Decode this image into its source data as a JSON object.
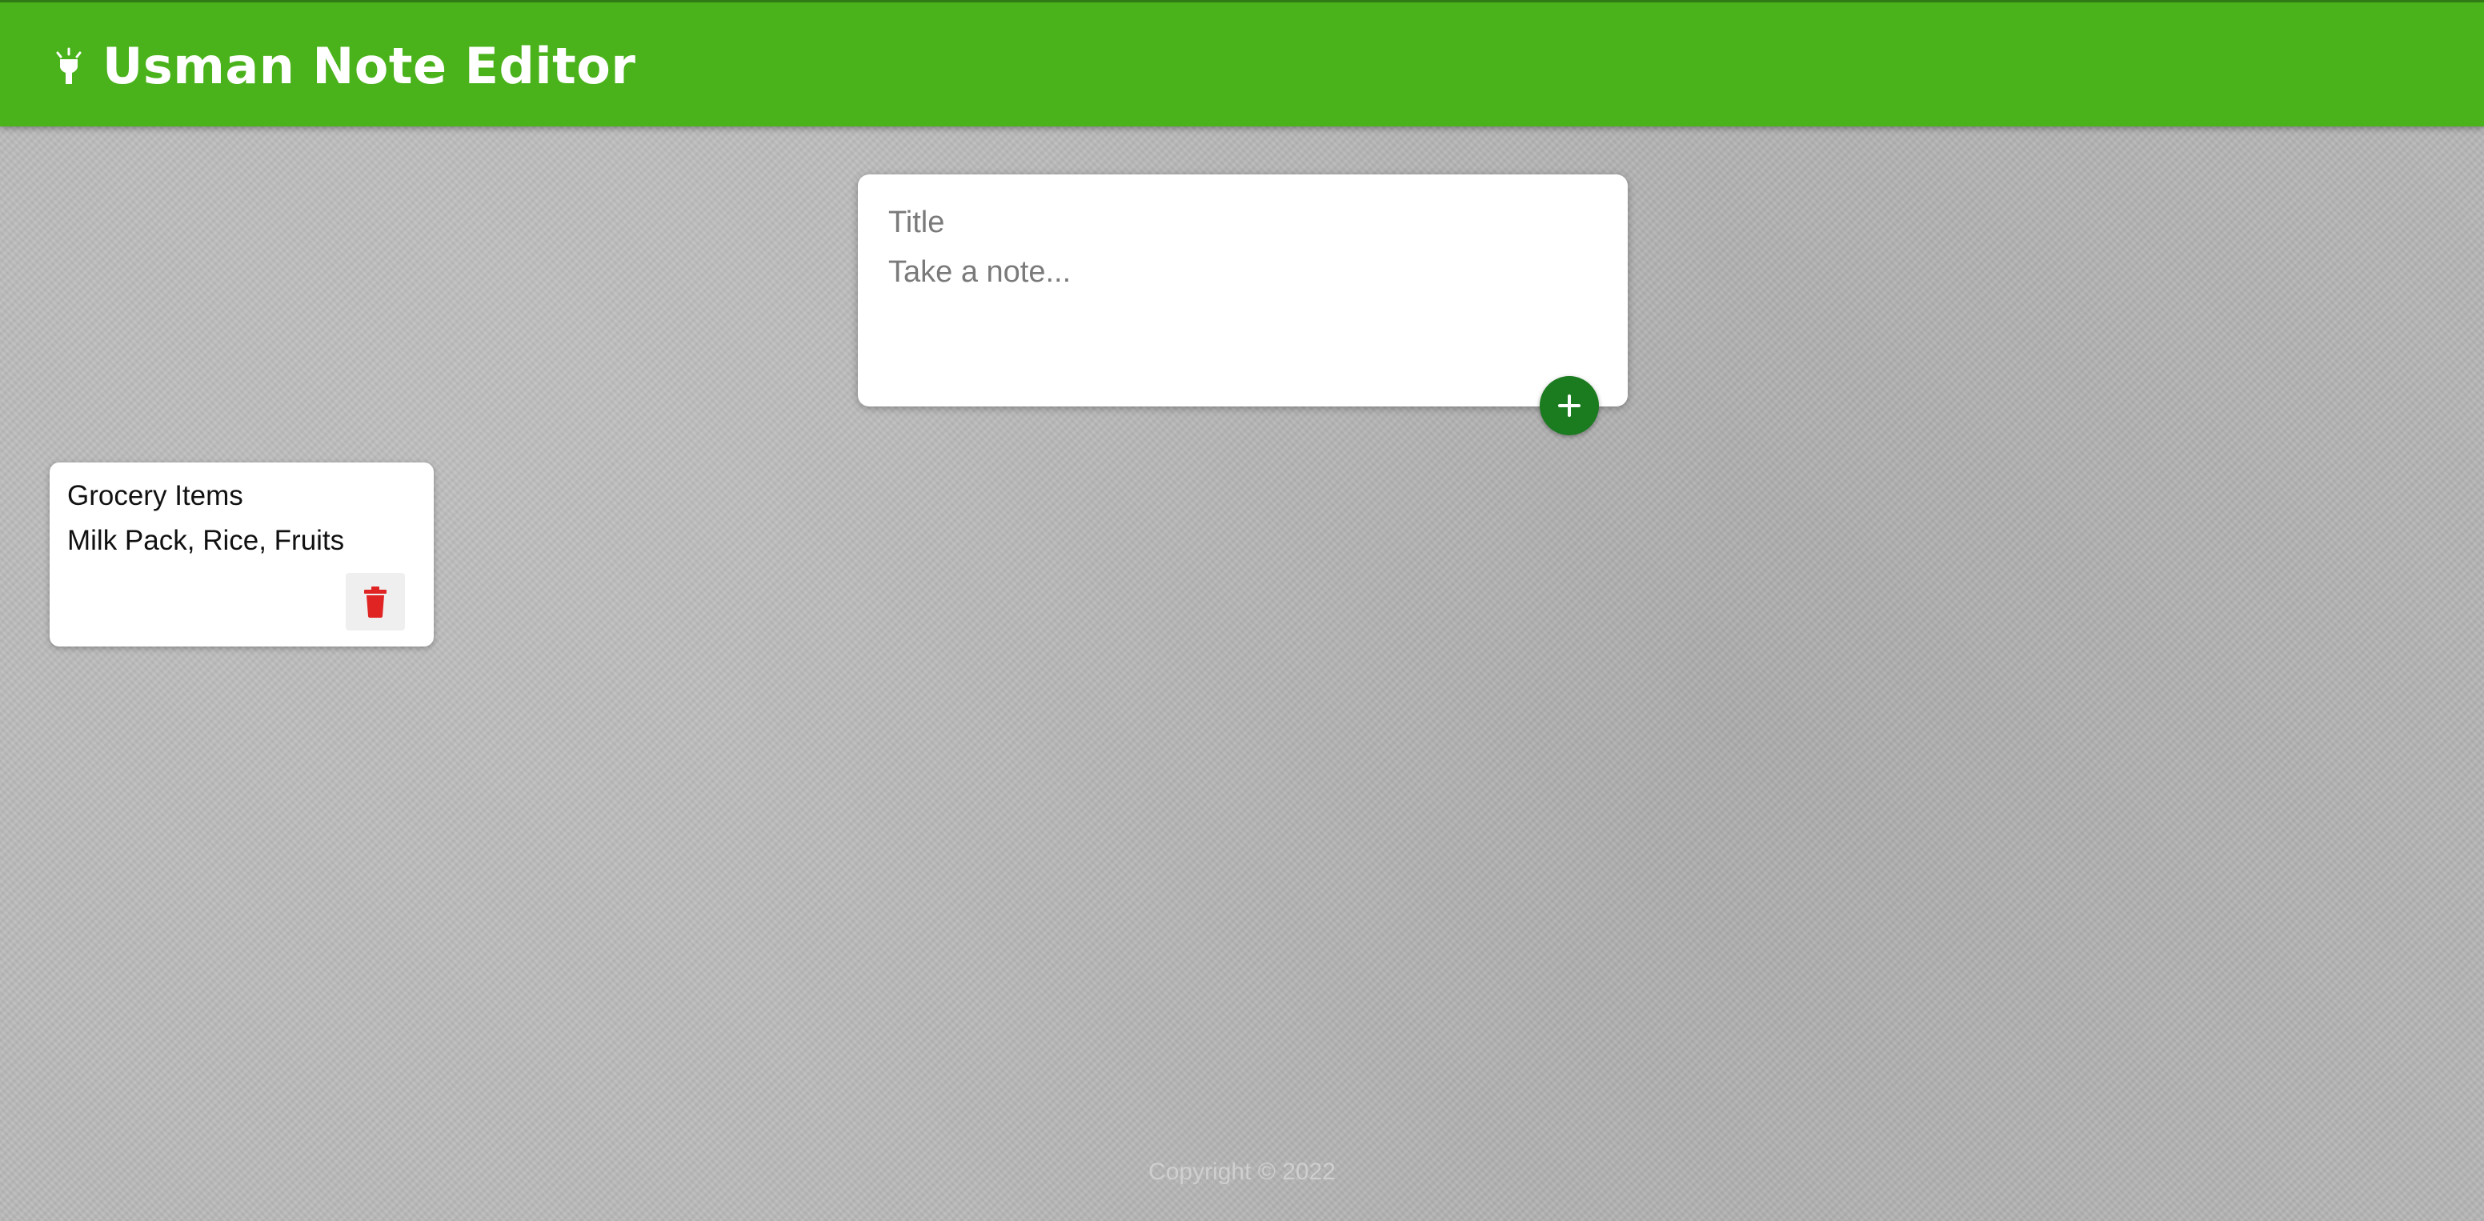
{
  "header": {
    "title": "Usman Note Editor",
    "icon": "lightbulb-icon",
    "background_color": "#4ab21b"
  },
  "create_note": {
    "title_placeholder": "Title",
    "title_value": "",
    "content_placeholder": "Take a note...",
    "content_value": "",
    "add_button_icon": "plus-icon",
    "add_button_color": "#1a7b1f"
  },
  "notes": [
    {
      "title": "Grocery Items",
      "content": "Milk Pack, Rice, Fruits",
      "delete_icon": "trash-icon",
      "delete_icon_color": "#e02424"
    }
  ],
  "footer": {
    "text": "Copyright © 2022"
  }
}
